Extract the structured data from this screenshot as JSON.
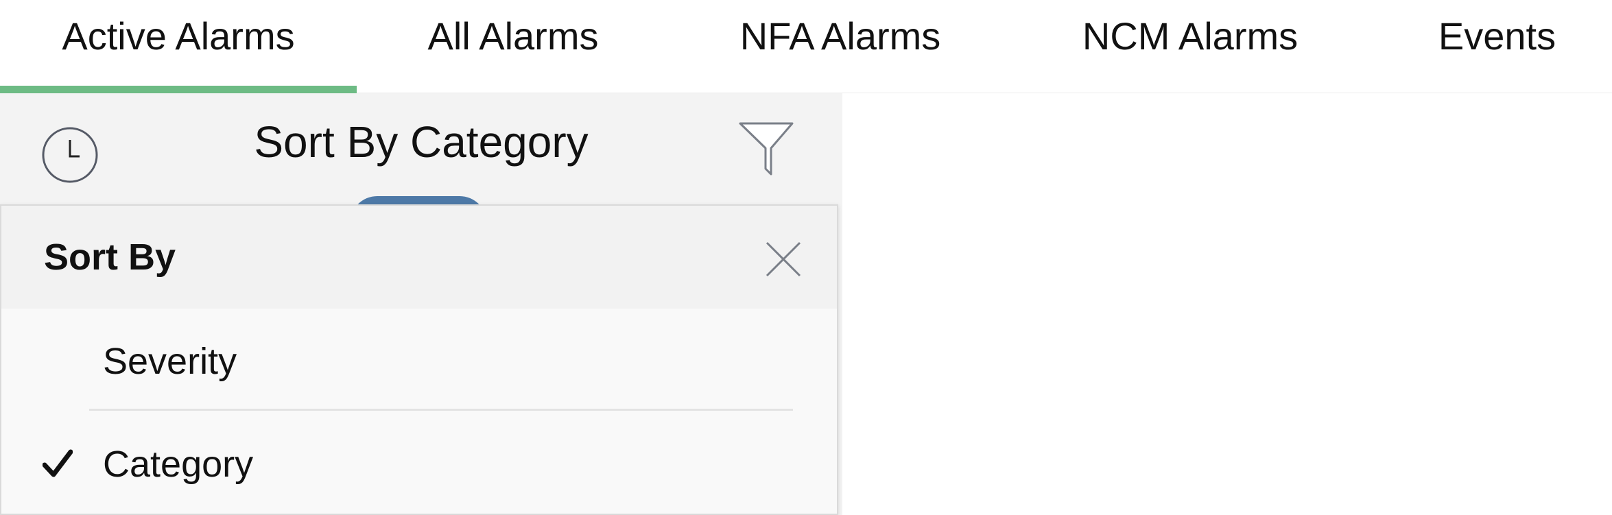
{
  "tabs": [
    {
      "label": "Active Alarms",
      "active": true
    },
    {
      "label": "All Alarms",
      "active": false
    },
    {
      "label": "NFA Alarms",
      "active": false
    },
    {
      "label": "NCM Alarms",
      "active": false
    },
    {
      "label": "Events",
      "active": false
    }
  ],
  "colors": {
    "active_tab_indicator": "#6dbb84",
    "panel_background": "#f3f3f3",
    "popup_background": "#f9f9f9",
    "peek_accent": "#4d79a7"
  },
  "panel": {
    "title": "Sort By Category",
    "left_icon": "clock-icon",
    "right_icon": "filter-icon"
  },
  "sort_popup": {
    "title": "Sort By",
    "close_icon": "close-icon",
    "options": [
      {
        "label": "Severity",
        "selected": false
      },
      {
        "label": "Category",
        "selected": true
      }
    ]
  }
}
